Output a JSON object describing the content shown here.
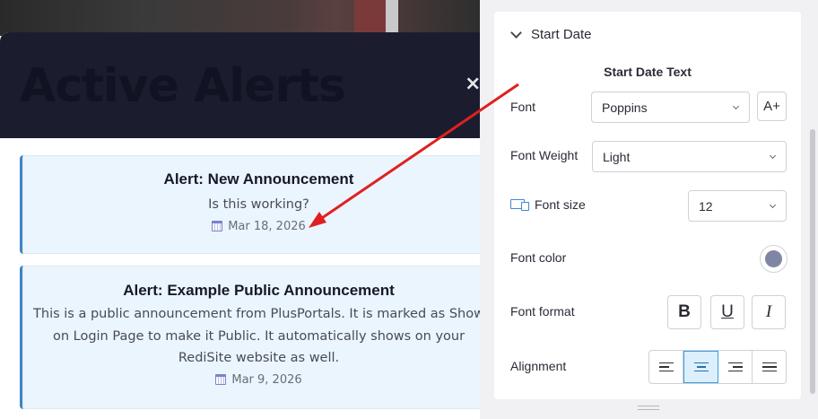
{
  "modal": {
    "title": "Active Alerts",
    "close_glyph": "×",
    "alerts": [
      {
        "title": "Alert: New Announcement",
        "body": "Is this working?",
        "date": "Mar 18, 2026"
      },
      {
        "title": "Alert: Example Public Announcement",
        "body": "This is a public announcement from PlusPortals. It is marked as Show on Login Page to make it Public. It automatically shows on your RediSite website as well.",
        "date": "Mar 9, 2026"
      }
    ]
  },
  "panel": {
    "section_title": "Start Date",
    "subheading": "Start Date Text",
    "font": {
      "label": "Font",
      "value": "Poppins",
      "font_button_glyph": "A+"
    },
    "font_weight": {
      "label": "Font Weight",
      "value": "Light"
    },
    "font_size": {
      "label": "Font size",
      "value": "12"
    },
    "font_color": {
      "label": "Font color",
      "color": "#7f86a3"
    },
    "font_format": {
      "label": "Font format",
      "bold": "B",
      "underline": "U",
      "italic": "I"
    },
    "alignment": {
      "label": "Alignment",
      "options": [
        "left",
        "center",
        "right",
        "justify"
      ],
      "selected": "center"
    }
  },
  "annotation": {
    "arrow_color": "#e02020"
  }
}
